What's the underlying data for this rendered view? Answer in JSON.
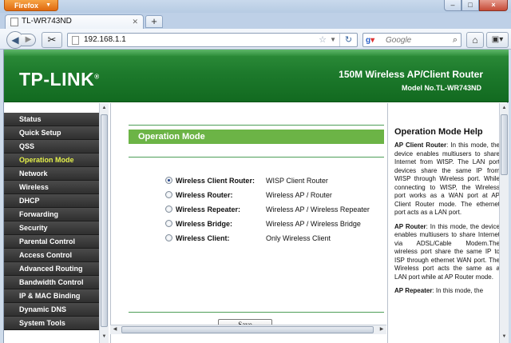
{
  "browser": {
    "app_button": "Firefox",
    "tab_title": "TL-WR743ND",
    "new_tab": "+",
    "url": "192.168.1.1",
    "search_engine": "Google",
    "search_placeholder": "Google",
    "win_min": "–",
    "win_max": "□",
    "win_close": "×"
  },
  "banner": {
    "logo": "TP-LINK",
    "product": "150M Wireless AP/Client Router",
    "model": "Model No.TL-WR743ND"
  },
  "sidebar": {
    "items": [
      {
        "label": "Status"
      },
      {
        "label": "Quick Setup"
      },
      {
        "label": "QSS"
      },
      {
        "label": "Operation Mode",
        "active": true
      },
      {
        "label": "Network"
      },
      {
        "label": "Wireless"
      },
      {
        "label": "DHCP"
      },
      {
        "label": "Forwarding"
      },
      {
        "label": "Security"
      },
      {
        "label": "Parental Control"
      },
      {
        "label": "Access Control"
      },
      {
        "label": "Advanced Routing"
      },
      {
        "label": "Bandwidth Control"
      },
      {
        "label": "IP & MAC Binding"
      },
      {
        "label": "Dynamic DNS"
      },
      {
        "label": "System Tools"
      }
    ]
  },
  "main": {
    "section_title": "Operation Mode",
    "options": [
      {
        "label": "Wireless Client Router:",
        "desc": "WISP Client Router",
        "checked": true
      },
      {
        "label": "Wireless Router:",
        "desc": "Wireless AP / Router",
        "checked": false
      },
      {
        "label": "Wireless Repeater:",
        "desc": "Wireless AP / Wireless Repeater",
        "checked": false
      },
      {
        "label": "Wireless Bridge:",
        "desc": "Wireless AP / Wireless Bridge",
        "checked": false
      },
      {
        "label": "Wireless Client:",
        "desc": "Only Wireless Client",
        "checked": false
      }
    ],
    "save_label": "Save"
  },
  "help": {
    "title": "Operation Mode Help",
    "paragraphs": [
      {
        "term": "AP Client Router",
        "sep": ": ",
        "text": "In this mode, the device enables multiusers to share Internet from WISP. The LAN port devices share the same IP from WISP through Wireless port. While connecting to WISP, the Wireless port works as a WAN port at AP Client Router mode. The ethernet port acts as a LAN port."
      },
      {
        "term": "AP Router",
        "sep": ": ",
        "text": "In this mode, the device enables multiusers to share Internet via ADSL/Cable Modem.The wireless port share the same IP to ISP through ethernet WAN port. The Wireless port acts the same as a LAN port while at AP Router mode."
      },
      {
        "term": "AP Repeater",
        "sep": ": ",
        "text": "In this mode, the"
      }
    ]
  }
}
